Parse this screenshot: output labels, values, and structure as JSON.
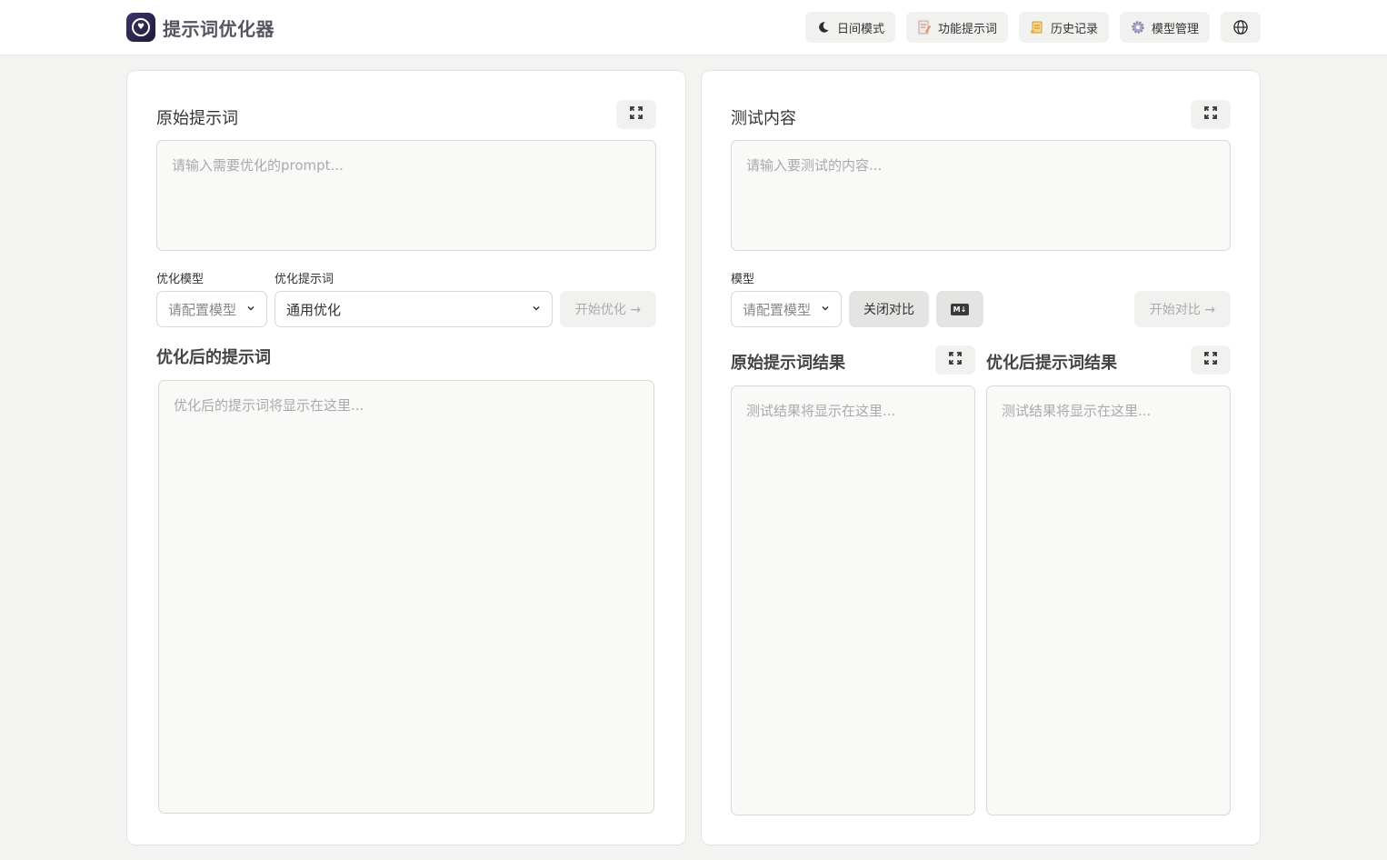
{
  "header": {
    "app_title": "提示词优化器",
    "nav": [
      {
        "label": "日间模式",
        "icon": "moon-icon"
      },
      {
        "label": "功能提示词",
        "icon": "document-icon"
      },
      {
        "label": "历史记录",
        "icon": "scroll-icon"
      },
      {
        "label": "模型管理",
        "icon": "gear-icon"
      }
    ],
    "language_icon": "globe-icon"
  },
  "left_panel": {
    "title": "原始提示词",
    "prompt_placeholder": "请输入需要优化的prompt...",
    "model_label": "优化模型",
    "model_select": "请配置模型",
    "template_label": "优化提示词",
    "template_select": "通用优化",
    "optimize_button": "开始优化 →",
    "optimized_title": "优化后的提示词",
    "optimized_placeholder": "优化后的提示词将显示在这里..."
  },
  "right_panel": {
    "title": "测试内容",
    "test_placeholder": "请输入要测试的内容...",
    "model_label": "模型",
    "model_select": "请配置模型",
    "compare_toggle": "关闭对比",
    "markdown_badge": "M↓",
    "compare_button": "开始对比 →",
    "original_result_title": "原始提示词结果",
    "optimized_result_title": "优化后提示词结果",
    "result_placeholder_original": "测试结果将显示在这里...",
    "result_placeholder_optimized": "测试结果将显示在这里..."
  }
}
